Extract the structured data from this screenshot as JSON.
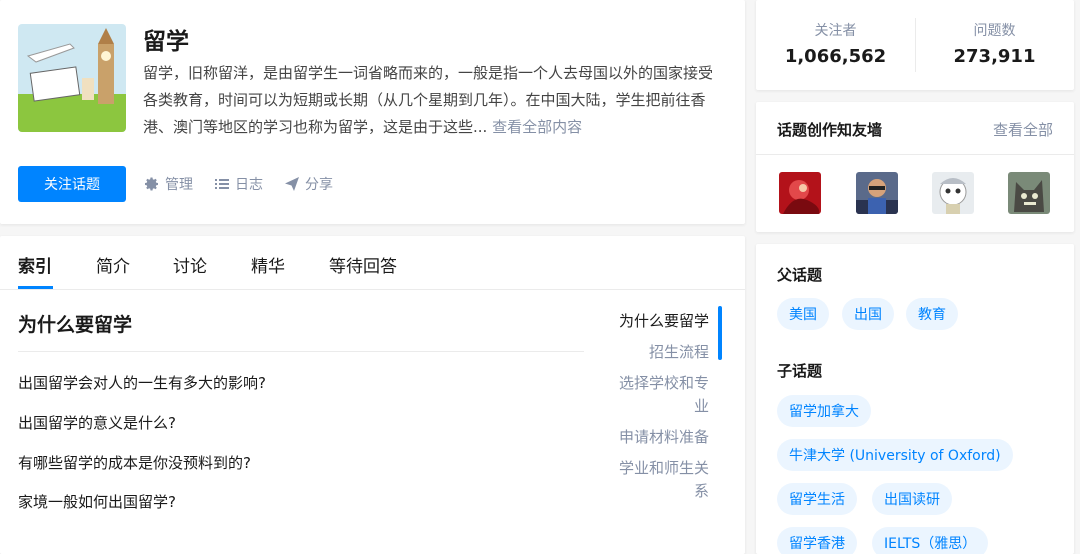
{
  "topic": {
    "title": "留学",
    "description": "留学，旧称留洋，是由留学生一词省略而来的，一般是指一个人去母国以外的国家接受各类教育，时间可以为短期或长期（从几个星期到几年）。在中国大陆，学生把前往香港、澳门等地区的学习也称为留学，这是由于这些...",
    "view_all": "查看全部内容",
    "image_icon": "topic-illustration"
  },
  "actions": {
    "follow": "关注话题",
    "manage": "管理",
    "log": "日志",
    "share": "分享"
  },
  "tabs": [
    "索引",
    "简介",
    "讨论",
    "精华",
    "等待回答"
  ],
  "index": {
    "section_title": "为什么要留学",
    "questions": [
      "出国留学会对人的一生有多大的影响?",
      "出国留学的意义是什么?",
      "有哪些留学的成本是你没预料到的?",
      "家境一般如何出国留学?"
    ],
    "toc": [
      "为什么要留学",
      "招生流程",
      "选择学校和专业",
      "申请材料准备",
      "学业和师生关系"
    ]
  },
  "stats": {
    "followers_label": "关注者",
    "followers": "1,066,562",
    "questions_label": "问题数",
    "questions": "273,911"
  },
  "contributors": {
    "title": "话题创作知友墙",
    "view_all": "查看全部",
    "avatars": [
      "avatar-red",
      "avatar-man",
      "avatar-cartoon",
      "avatar-cat"
    ]
  },
  "topics": {
    "parent_label": "父话题",
    "parents": [
      "美国",
      "出国",
      "教育"
    ],
    "child_label": "子话题",
    "children": [
      "留学加拿大",
      "牛津大学 (University of Oxford)",
      "留学生活",
      "出国读研",
      "留学香港",
      "IELTS（雅思）"
    ]
  },
  "colors": {
    "accent": "#0084ff",
    "tag_bg": "#ebf5ff",
    "muted": "#8590a6"
  }
}
